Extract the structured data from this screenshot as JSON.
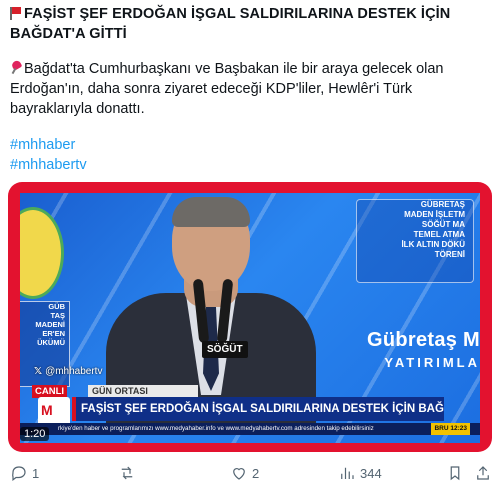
{
  "post": {
    "title": "FAŞİST ŞEF ERDOĞAN İŞGAL SALDIRILARINA DESTEK İÇİN BAĞDAT'A GİTTİ",
    "body": "Bağdat'ta Cumhurbaşkanı ve Başbakan ile bir araya gelecek olan Erdoğan'ın, daha sonra ziyaret edeceği KDP'liler, Hewlêr'i Türk bayraklarıyla donattı.",
    "hashtags": [
      "#mhhaber",
      "#mhhabertv"
    ]
  },
  "video": {
    "watermark": "@mhhabertv",
    "podium_label": "SÖĞÜT",
    "left_panel_lines": [
      "GÜB",
      "TAŞ",
      "MADENİ",
      "ER'EN",
      "ÜKÜMÜ"
    ],
    "right_panel_lines": [
      "GÜBRETAŞ",
      "MADEN İŞLETM",
      "SÖĞÜT MA",
      "TEMEL ATMA",
      "İLK ALTIN DÖKÜ",
      "TÖRENİ"
    ],
    "brand": "Gübretaş M",
    "brand_sub": "YATIRIMLA",
    "ticker": {
      "live_label": "CANLI",
      "program": "GÜN ORTASI",
      "logo_text": "M",
      "headline": "FAŞİST ŞEF ERDOĞAN İŞGAL SALDIRILARINA DESTEK İÇİN BAĞDAT'A GİTTİ",
      "crawl": "rkiye'den haber ve programlarımızı www.medyahaber.info ve www.medyahabertv.com adresinden takip edebilirsiniz",
      "clock": "BRU 12:23"
    },
    "duration": "1:20"
  },
  "actions": {
    "replies": "1",
    "reposts": "",
    "likes": "2",
    "views": "344"
  },
  "colors": {
    "accent": "#1d9bf0",
    "frame": "#e3122f",
    "ticker_bg": "#0f2f88"
  }
}
